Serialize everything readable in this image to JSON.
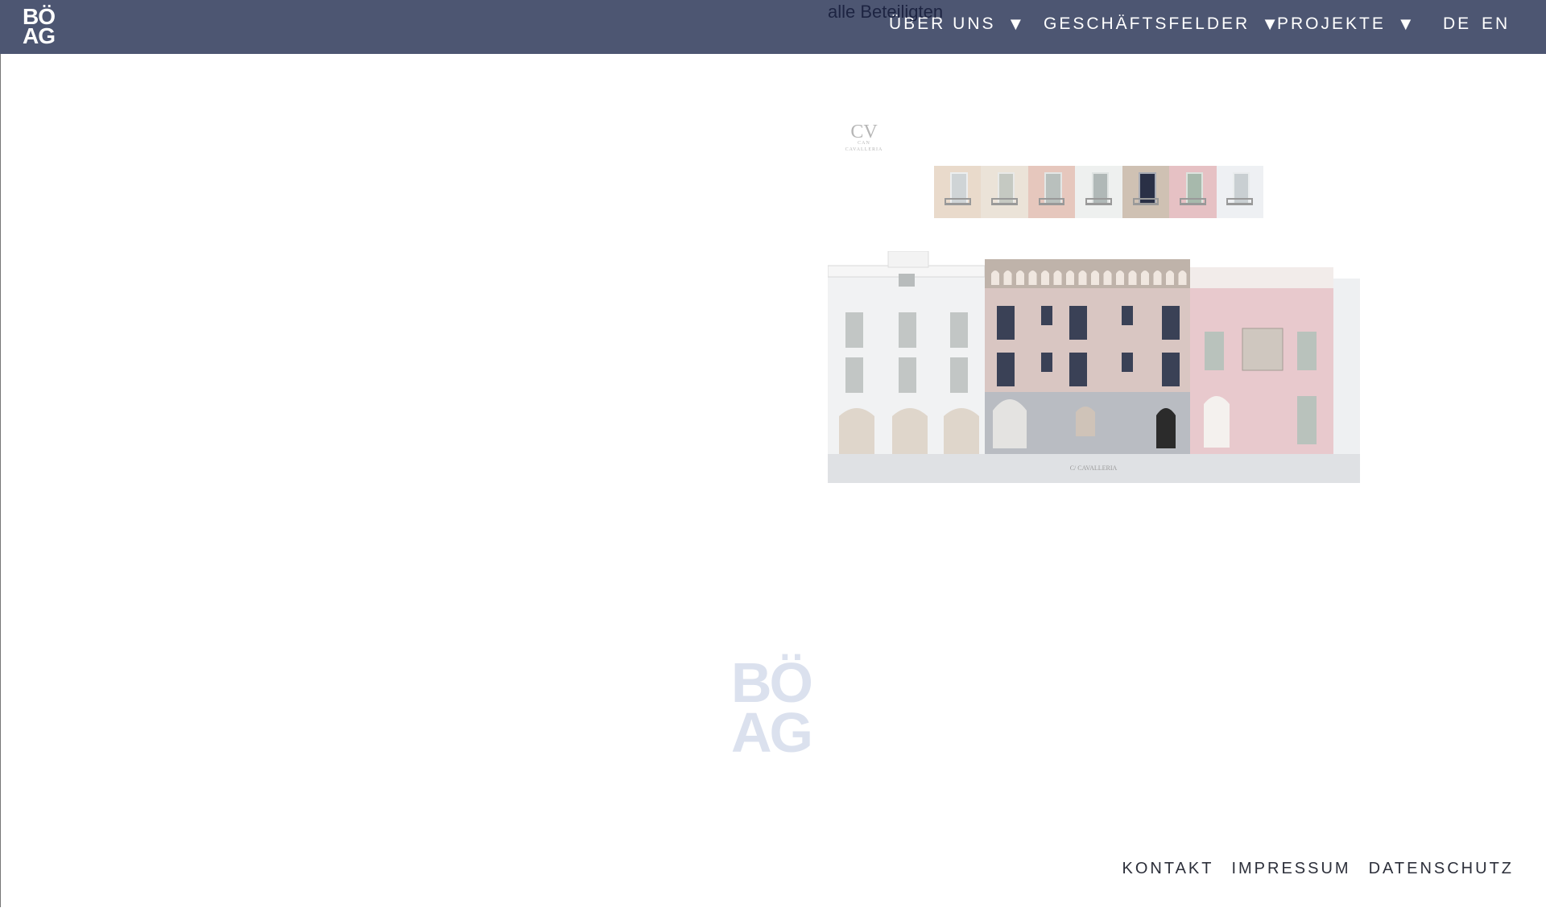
{
  "brand": {
    "logo_line1": "BÖ",
    "logo_line2": "AG"
  },
  "floating_text": "alle Beteiligten",
  "nav": {
    "items": [
      {
        "label": "ÜBER UNS",
        "arrow": "▼"
      },
      {
        "label": "GESCHÄFTSFELDER",
        "arrow": "▼"
      },
      {
        "label": "PROJEKTE",
        "arrow": "▼"
      }
    ],
    "languages": [
      "DE",
      "EN"
    ]
  },
  "project": {
    "monogram": "CV",
    "monogram_sub": "CAN CAVALLERIA",
    "facade_caption": "C/ CAVALLERIA",
    "thumb_colors": [
      "#e9dacb",
      "#ebe3d8",
      "#e6c7bd",
      "#eef0ef",
      "#cfc1b3",
      "#e6c1c4",
      "#eef0f3"
    ],
    "thumb_window_colors": [
      "#cfd4d6",
      "#c5c9c2",
      "#b9c0bd",
      "#b0b8b7",
      "#2a3046",
      "#a7b9ac",
      "#c9cfd2"
    ]
  },
  "watermark": {
    "line1": "BÖ",
    "line2": "AG"
  },
  "footer": {
    "links": [
      "KONTAKT",
      "IMPRESSUM",
      "DATENSCHUTZ"
    ]
  },
  "colors": {
    "header": "#4d5672",
    "watermark": "#dbe1ee",
    "pink": "#e8c9cd",
    "taupe": "#d9c6c2"
  }
}
